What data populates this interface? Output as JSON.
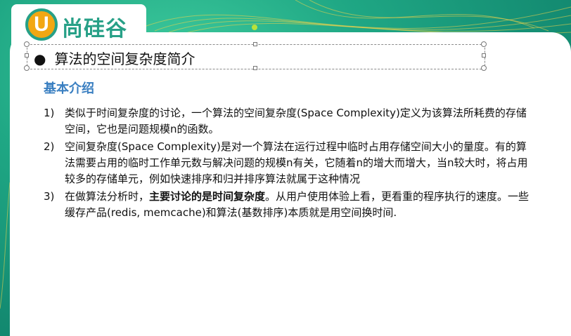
{
  "logo": {
    "letter": "U",
    "text": "尚硅谷"
  },
  "title": {
    "bullet": "●",
    "text": "算法的空间复杂度简介"
  },
  "subtitle": "基本介绍",
  "items": [
    {
      "num": "1)",
      "text": "类似于时间复杂度的讨论，一个算法的空间复杂度(Space Complexity)定义为该算法所耗费的存储空间，它也是问题规模n的函数。"
    },
    {
      "num": "2)",
      "text": "空间复杂度(Space Complexity)是对一个算法在运行过程中临时占用存储空间大小的量度。有的算法需要占用的临时工作单元数与解决问题的规模n有关，它随着n的增大而增大，当n较大时，将占用较多的存储单元，例如快速排序和归并排序算法就属于这种情况"
    },
    {
      "num": "3)",
      "text_before": "在做算法分析时，",
      "text_bold": "主要讨论的是时间复杂度",
      "text_after": "。从用户使用体验上看，更看重的程序执行的速度。一些缓存产品(redis, memcache)和算法(基数排序)本质就是用空间换时间."
    }
  ],
  "colors": {
    "accent": "#1f9a7f",
    "subtitle": "#3a7fc1",
    "logo_orange": "#f2a713"
  }
}
